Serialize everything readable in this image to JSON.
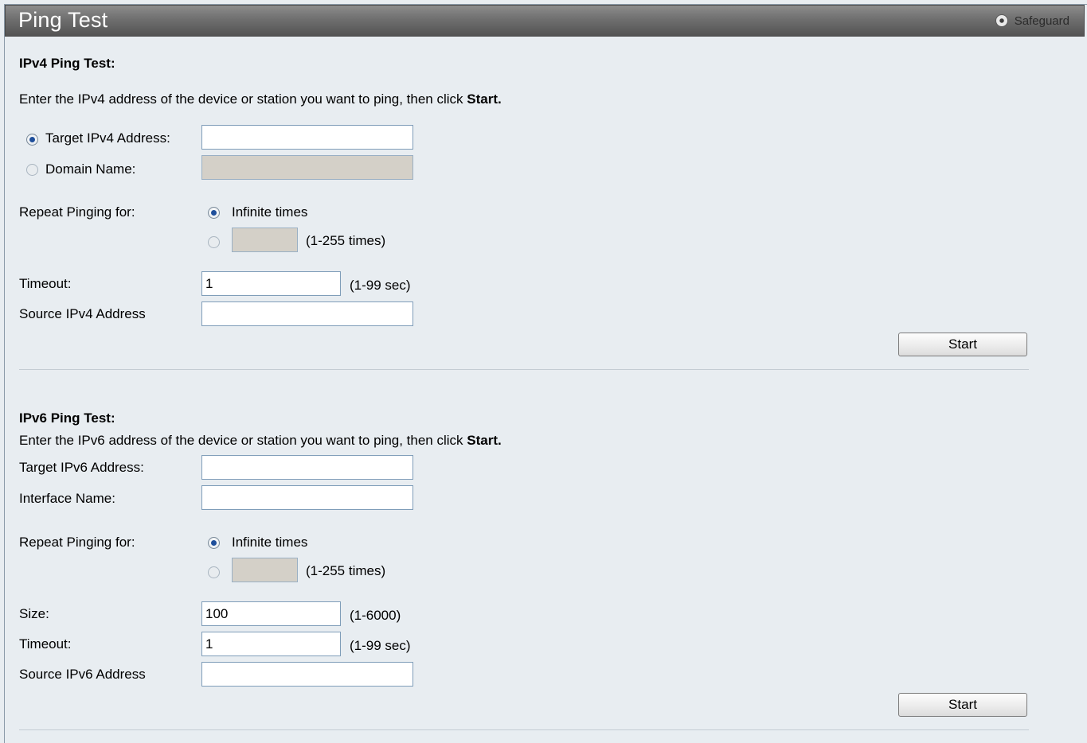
{
  "header": {
    "title": "Ping Test",
    "safeguard_label": "Safeguard"
  },
  "ipv4": {
    "heading": "IPv4 Ping Test:",
    "instruction": "Enter the IPv4 address of the device or station you want to ping, then click",
    "instruction_bold": "Start.",
    "target_label": "Target IPv4 Address:",
    "target_value": "",
    "domain_label": "Domain Name:",
    "domain_value": "",
    "repeat_label": "Repeat Pinging for:",
    "infinite_label": "Infinite times",
    "times_value": "",
    "times_range": "(1-255 times)",
    "timeout_label": "Timeout:",
    "timeout_value": "1",
    "timeout_range": "(1-99 sec)",
    "source_label": "Source IPv4 Address",
    "source_value": "",
    "start_label": "Start",
    "selected_address_mode": "target",
    "selected_repeat_mode": "infinite"
  },
  "ipv6": {
    "heading": "IPv6 Ping Test:",
    "instruction": "Enter the IPv6 address of the device or station you want to ping, then click",
    "instruction_bold": "Start.",
    "target_label": "Target IPv6 Address:",
    "target_value": "",
    "interface_label": "Interface Name:",
    "interface_value": "",
    "repeat_label": "Repeat Pinging for:",
    "infinite_label": "Infinite times",
    "times_value": "",
    "times_range": "(1-255 times)",
    "size_label": "Size:",
    "size_value": "100",
    "size_range": "(1-6000)",
    "timeout_label": "Timeout:",
    "timeout_value": "1",
    "timeout_range": "(1-99 sec)",
    "source_label": "Source IPv6 Address",
    "source_value": "",
    "start_label": "Start",
    "selected_repeat_mode": "infinite"
  }
}
